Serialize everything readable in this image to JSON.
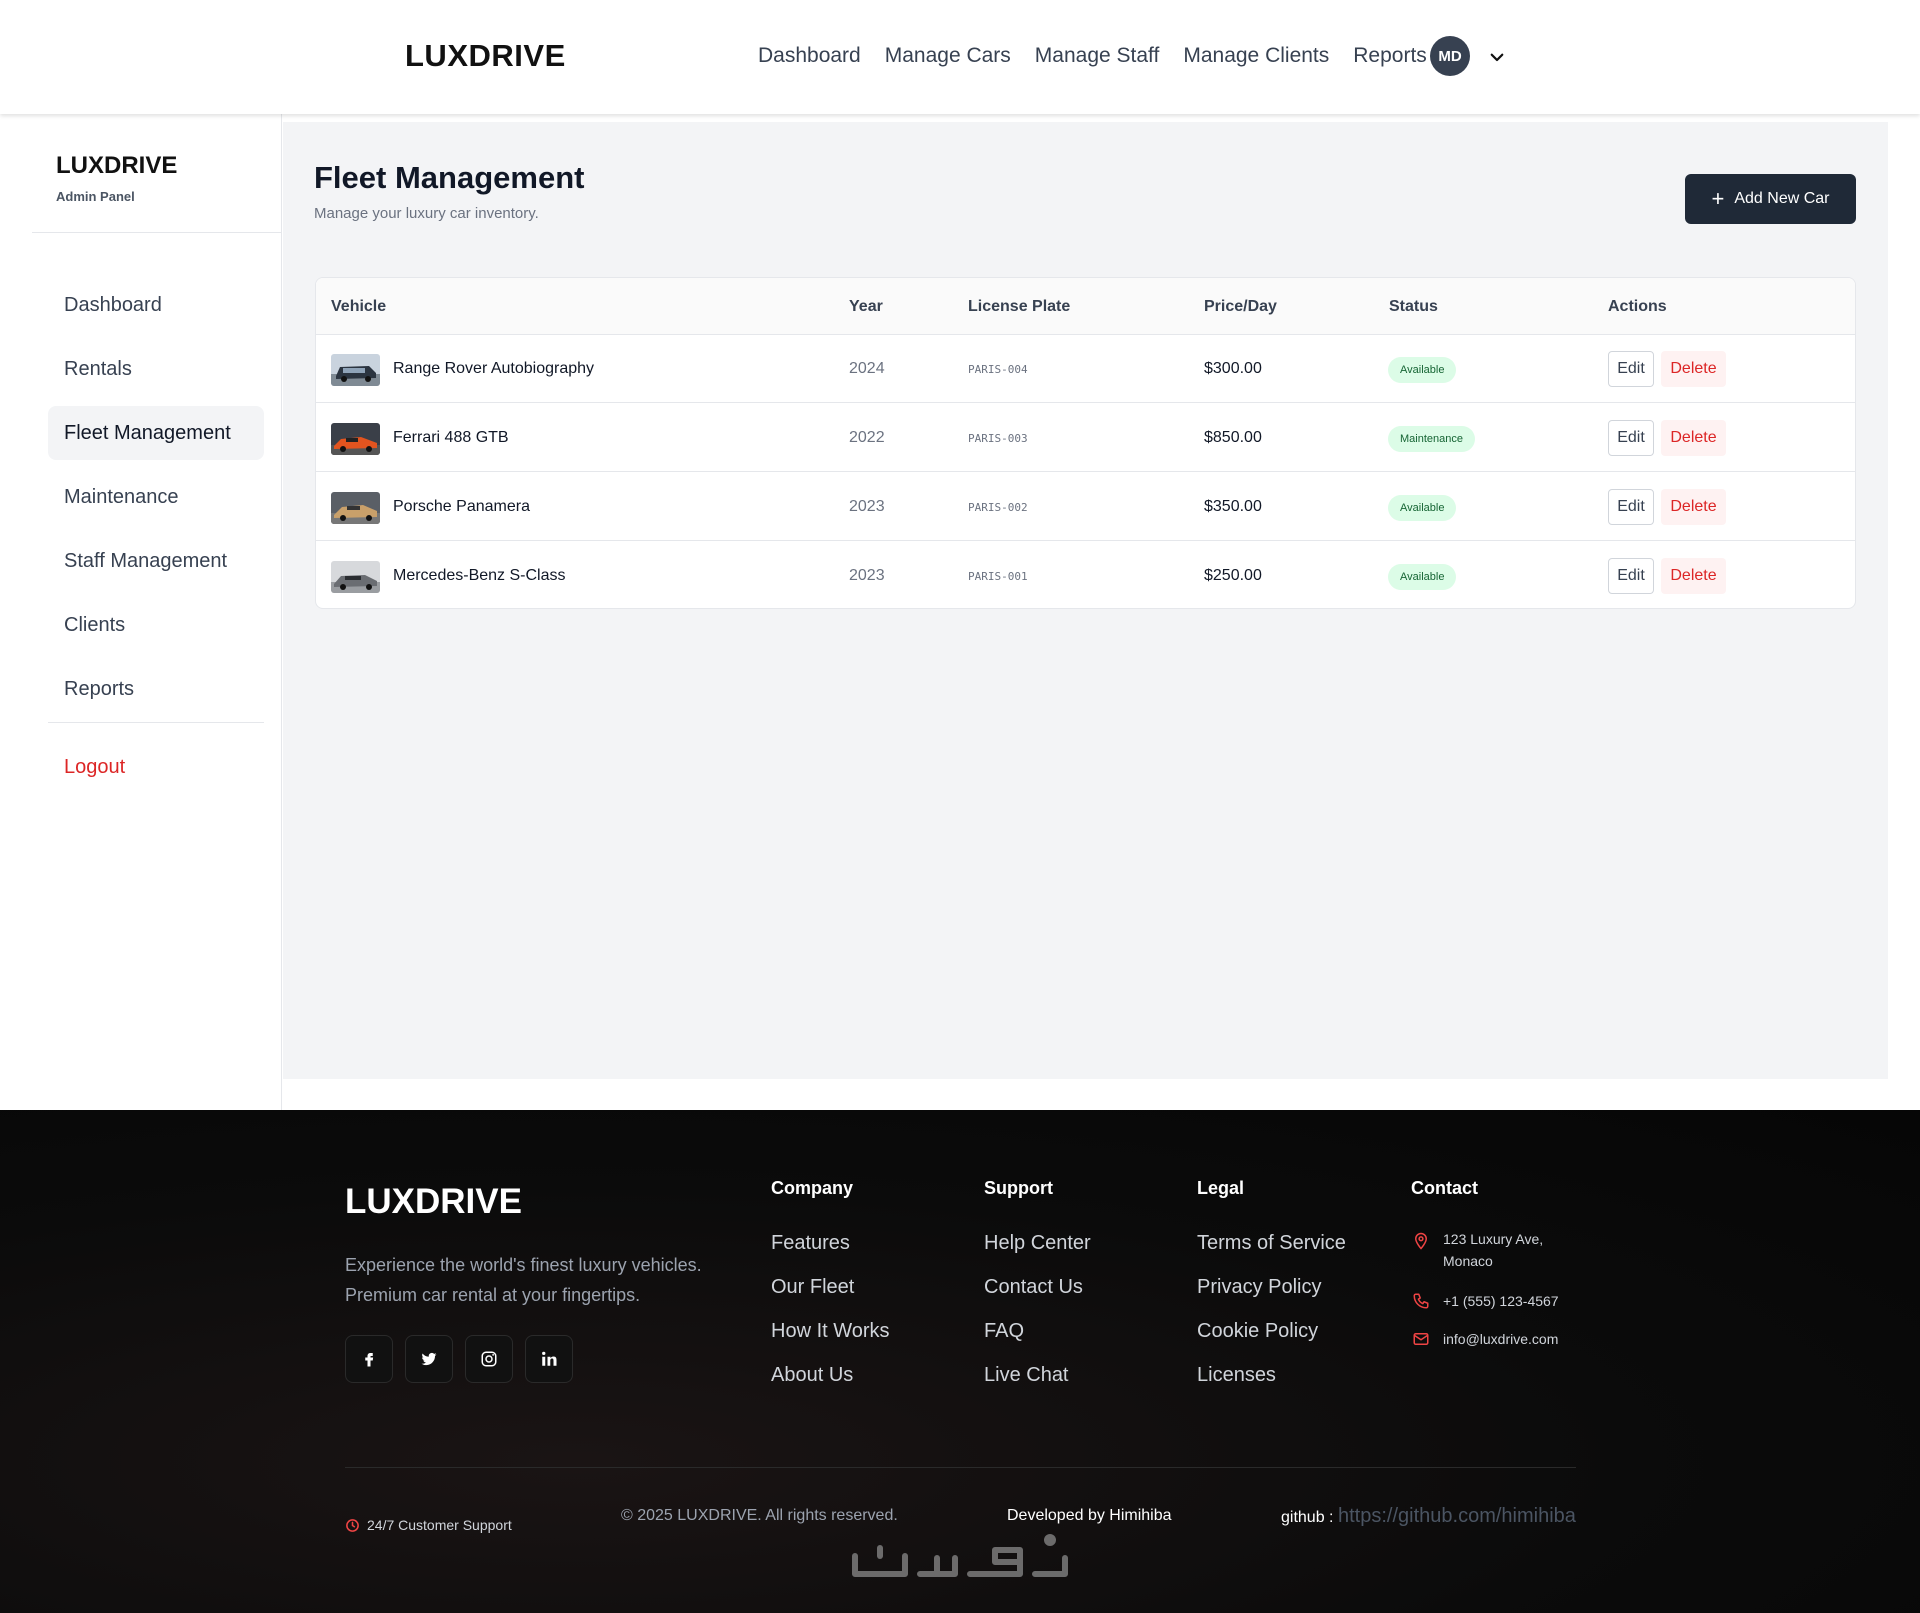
{
  "topbar": {
    "brand": "LUXDRIVE",
    "nav": [
      "Dashboard",
      "Manage Cars",
      "Manage Staff",
      "Manage Clients",
      "Reports"
    ],
    "avatar_initials": "MD"
  },
  "sidebar": {
    "brand": "LUXDRIVE",
    "subtitle": "Admin Panel",
    "items": [
      "Dashboard",
      "Rentals",
      "Fleet Management",
      "Maintenance",
      "Staff Management",
      "Clients",
      "Reports"
    ],
    "active_item": "Fleet Management",
    "logout": "Logout"
  },
  "main": {
    "title": "Fleet Management",
    "subtitle": "Manage your luxury car inventory.",
    "add_button": "Add New Car",
    "columns": [
      "Vehicle",
      "Year",
      "License Plate",
      "Price/Day",
      "Status",
      "Actions"
    ],
    "rows": [
      {
        "vehicle": "Range Rover Autobiography",
        "year": "2024",
        "plate": "PARIS-004",
        "price": "$300.00",
        "status": "Available",
        "edit": "Edit",
        "delete": "Delete"
      },
      {
        "vehicle": "Ferrari 488 GTB",
        "year": "2022",
        "plate": "PARIS-003",
        "price": "$850.00",
        "status": "Maintenance",
        "edit": "Edit",
        "delete": "Delete"
      },
      {
        "vehicle": "Porsche Panamera",
        "year": "2023",
        "plate": "PARIS-002",
        "price": "$350.00",
        "status": "Available",
        "edit": "Edit",
        "delete": "Delete"
      },
      {
        "vehicle": "Mercedes-Benz S-Class",
        "year": "2023",
        "plate": "PARIS-001",
        "price": "$250.00",
        "status": "Available",
        "edit": "Edit",
        "delete": "Delete"
      }
    ]
  },
  "footer": {
    "brand": "LUXDRIVE",
    "description": "Experience the world's finest luxury vehicles. Premium car rental at your fingertips.",
    "social": [
      "facebook-icon",
      "twitter-icon",
      "instagram-icon",
      "linkedin-icon"
    ],
    "company": {
      "title": "Company",
      "links": [
        "Features",
        "Our Fleet",
        "How It Works",
        "About Us"
      ]
    },
    "support": {
      "title": "Support",
      "links": [
        "Help Center",
        "Contact Us",
        "FAQ",
        "Live Chat"
      ]
    },
    "legal": {
      "title": "Legal",
      "links": [
        "Terms of Service",
        "Privacy Policy",
        "Cookie Policy",
        "Licenses"
      ]
    },
    "contact": {
      "title": "Contact",
      "address_line1": "123 Luxury Ave,",
      "address_line2": "Monaco",
      "phone": "+1 (555) 123-4567",
      "email": "info@luxdrive.com"
    },
    "support_badge": "24/7 Customer Support",
    "copyright": "© 2025 LUXDRIVE. All rights reserved.",
    "developed_by": "Developed by Himihiba",
    "github_label": "github :",
    "github_url": "https://github.com/himihiba"
  },
  "colors": {
    "accent_dark": "#1f2937",
    "danger": "#dc2626",
    "success_bg": "#dcfce7",
    "success_text": "#166534"
  }
}
